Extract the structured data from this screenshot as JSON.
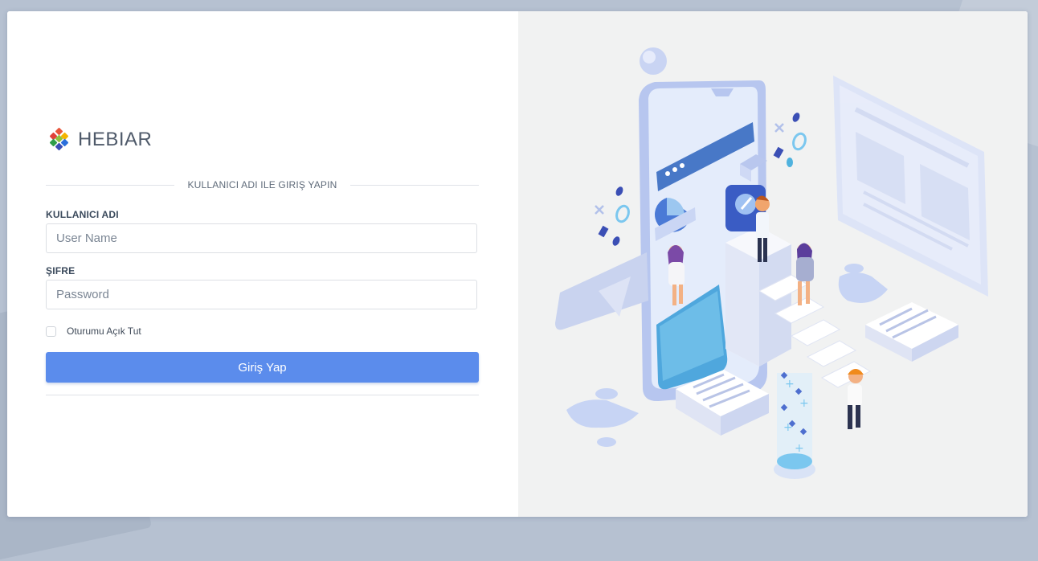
{
  "brand": {
    "name": "HEBIAR",
    "logo_icon": "hebiar-logo-icon"
  },
  "login": {
    "heading": "KULLANICI ADI ILE GIRIŞ YAPIN",
    "username_label": "KULLANICI ADI",
    "username_placeholder": "User Name",
    "username_value": "",
    "password_label": "ŞIFRE",
    "password_placeholder": "Password",
    "password_value": "",
    "remember_label": "Oturumu Açık Tut",
    "remember_checked": false,
    "submit_label": "Giriş Yap"
  },
  "illustration": {
    "icon": "isometric-mobile-app-illustration"
  },
  "colors": {
    "primary_button": "#5b8cec",
    "page_background": "#b6c1d1",
    "illustration_background": "#f1f2f2",
    "label_text": "#3b4a5c"
  }
}
